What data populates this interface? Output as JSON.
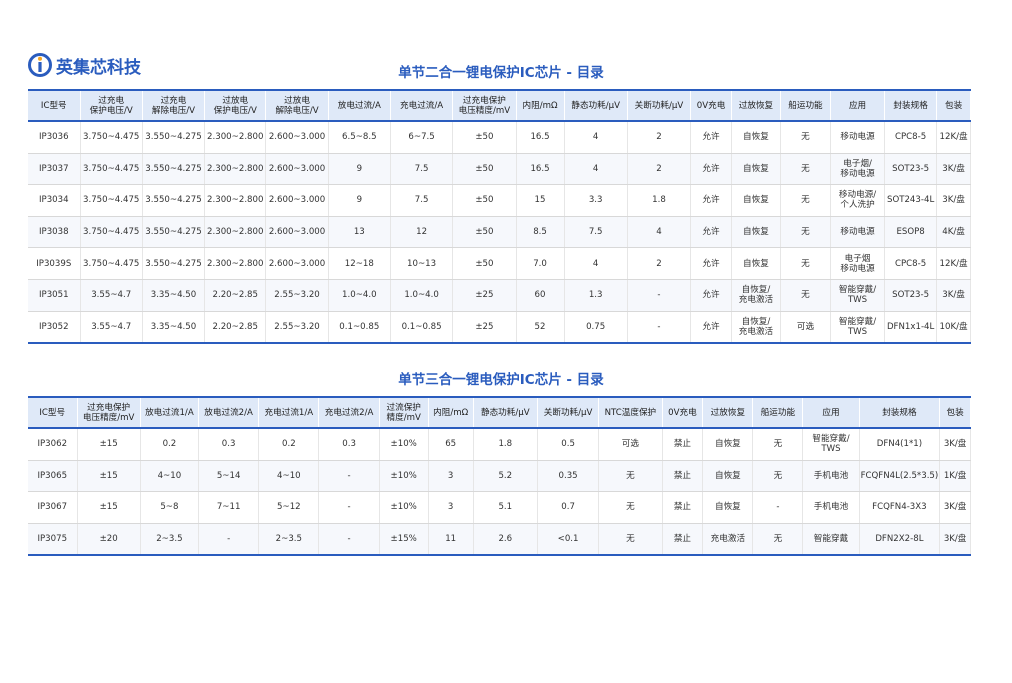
{
  "brand": {
    "name": "英集芯科技",
    "accent": "#2a5cbe",
    "secondary": "#f5a623"
  },
  "section1": {
    "title": "单节二合一锂电保护IC芯片 - 目录",
    "headers": [
      "IC型号",
      "过充电\n保护电压/V",
      "过充电\n解除电压/V",
      "过放电\n保护电压/V",
      "过放电\n解除电压/V",
      "放电过流/A",
      "充电过流/A",
      "过充电保护\n电压精度/mV",
      "内阻/mΩ",
      "静态功耗/μV",
      "关断功耗/μV",
      "0V充电",
      "过放恢复",
      "船运功能",
      "应用",
      "封装规格",
      "包装"
    ],
    "rows": [
      [
        "IP3036",
        "3.750~4.475",
        "3.550~4.275",
        "2.300~2.800",
        "2.600~3.000",
        "6.5~8.5",
        "6~7.5",
        "±50",
        "16.5",
        "4",
        "2",
        "允许",
        "自恢复",
        "无",
        "移动电源",
        "CPC8-5",
        "12K/盘"
      ],
      [
        "IP3037",
        "3.750~4.475",
        "3.550~4.275",
        "2.300~2.800",
        "2.600~3.000",
        "9",
        "7.5",
        "±50",
        "16.5",
        "4",
        "2",
        "允许",
        "自恢复",
        "无",
        "电子烟/\n移动电源",
        "SOT23-5",
        "3K/盘"
      ],
      [
        "IP3034",
        "3.750~4.475",
        "3.550~4.275",
        "2.300~2.800",
        "2.600~3.000",
        "9",
        "7.5",
        "±50",
        "15",
        "3.3",
        "1.8",
        "允许",
        "自恢复",
        "无",
        "移动电源/\n个人洗护",
        "SOT243-4L",
        "3K/盘"
      ],
      [
        "IP3038",
        "3.750~4.475",
        "3.550~4.275",
        "2.300~2.800",
        "2.600~3.000",
        "13",
        "12",
        "±50",
        "8.5",
        "7.5",
        "4",
        "允许",
        "自恢复",
        "无",
        "移动电源",
        "ESOP8",
        "4K/盘"
      ],
      [
        "IP3039S",
        "3.750~4.475",
        "3.550~4.275",
        "2.300~2.800",
        "2.600~3.000",
        "12~18",
        "10~13",
        "±50",
        "7.0",
        "4",
        "2",
        "允许",
        "自恢复",
        "无",
        "电子烟\n移动电源",
        "CPC8-5",
        "12K/盘"
      ],
      [
        "IP3051",
        "3.55~4.7",
        "3.35~4.50",
        "2.20~2.85",
        "2.55~3.20",
        "1.0~4.0",
        "1.0~4.0",
        "±25",
        "60",
        "1.3",
        "-",
        "允许",
        "自恢复/\n充电激活",
        "无",
        "智能穿戴/\nTWS",
        "SOT23-5",
        "3K/盘"
      ],
      [
        "IP3052",
        "3.55~4.7",
        "3.35~4.50",
        "2.20~2.85",
        "2.55~3.20",
        "0.1~0.85",
        "0.1~0.85",
        "±25",
        "52",
        "0.75",
        "-",
        "允许",
        "自恢复/\n充电激活",
        "可选",
        "智能穿戴/\nTWS",
        "DFN1x1-4L",
        "10K/盘"
      ]
    ]
  },
  "section2": {
    "title": "单节三合一锂电保护IC芯片 - 目录",
    "headers": [
      "IC型号",
      "过充电保护\n电压精度/mV",
      "放电过流1/A",
      "放电过流2/A",
      "充电过流1/A",
      "充电过流2/A",
      "过流保护\n精度/mV",
      "内阻/mΩ",
      "静态功耗/μV",
      "关断功耗/μV",
      "NTC温度保护",
      "0V充电",
      "过放恢复",
      "船运功能",
      "应用",
      "封装规格",
      "包装"
    ],
    "rows": [
      [
        "IP3062",
        "±15",
        "0.2",
        "0.3",
        "0.2",
        "0.3",
        "±10%",
        "65",
        "1.8",
        "0.5",
        "可选",
        "禁止",
        "自恢复",
        "无",
        "智能穿戴/\nTWS",
        "DFN4(1*1)",
        "3K/盘"
      ],
      [
        "IP3065",
        "±15",
        "4~10",
        "5~14",
        "4~10",
        "-",
        "±10%",
        "3",
        "5.2",
        "0.35",
        "无",
        "禁止",
        "自恢复",
        "无",
        "手机电池",
        "FCQFN4L(2.5*3.5)",
        "1K/盘"
      ],
      [
        "IP3067",
        "±15",
        "5~8",
        "7~11",
        "5~12",
        "-",
        "±10%",
        "3",
        "5.1",
        "0.7",
        "无",
        "禁止",
        "自恢复",
        "-",
        "手机电池",
        "FCQFN4-3X3",
        "3K/盘"
      ],
      [
        "IP3075",
        "±20",
        "2~3.5",
        "-",
        "2~3.5",
        "-",
        "±15%",
        "11",
        "2.6",
        "<0.1",
        "无",
        "禁止",
        "充电激活",
        "无",
        "智能穿戴",
        "DFN2X2-8L",
        "3K/盘"
      ]
    ]
  }
}
